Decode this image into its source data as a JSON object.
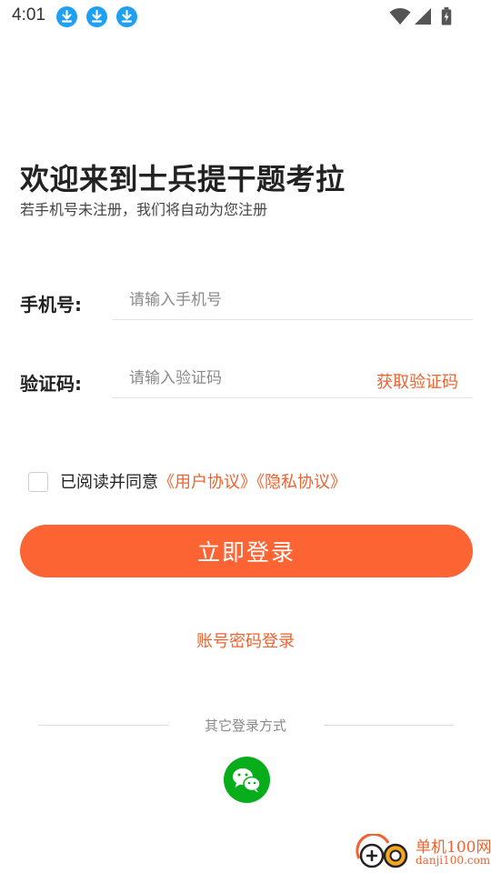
{
  "status_bar": {
    "time": "4:01",
    "icons": [
      "download-icon",
      "download-icon",
      "download-icon",
      "wifi-icon",
      "cell-signal-icon",
      "battery-charging-icon"
    ]
  },
  "header": {
    "title": "欢迎来到士兵提干题考拉",
    "subtitle": "若手机号未注册，我们将自动为您注册"
  },
  "form": {
    "phone_label": "手机号:",
    "phone_placeholder": "请输入手机号",
    "phone_value": "",
    "code_label": "验证码:",
    "code_placeholder": "请输入验证码",
    "code_value": "",
    "get_code": "获取验证码"
  },
  "agreement": {
    "checked": false,
    "text": "已阅读并同意",
    "user_agreement": "《用户协议》",
    "privacy_policy": "《隐私协议》"
  },
  "login_button": "立即登录",
  "password_login": "账号密码登录",
  "other_methods": {
    "label": "其它登录方式",
    "icons": [
      "wechat-icon"
    ]
  },
  "watermark": {
    "text": "单机100网",
    "url": "danji100.com"
  },
  "colors": {
    "accent": "#fc6434",
    "link": "#f0622f",
    "wechat": "#07ad1b",
    "download_badge": "#1ea0f5"
  }
}
